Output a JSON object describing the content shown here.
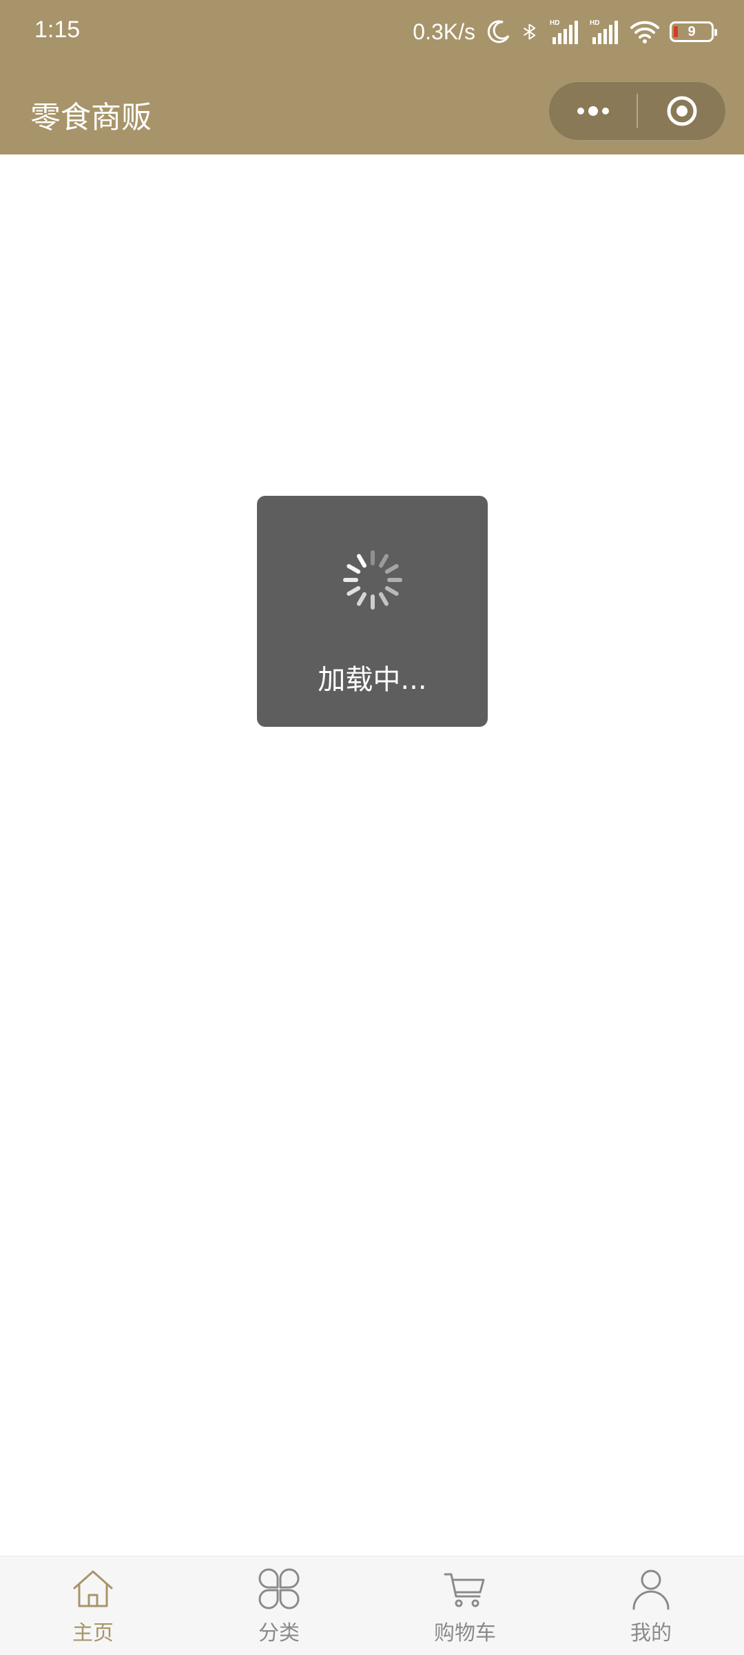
{
  "status_bar": {
    "time": "1:15",
    "net_speed": "0.3K/s",
    "battery": "9",
    "icons": [
      "moon-icon",
      "bluetooth-icon",
      "hd-signal-icon",
      "hd-signal-icon",
      "wifi-icon",
      "battery-icon"
    ]
  },
  "nav": {
    "title": "零食商贩",
    "capsule": {
      "more_icon": "more-dots-icon",
      "close_icon": "target-circle-icon"
    }
  },
  "loading": {
    "text": "加载中..."
  },
  "tabbar": {
    "tabs": [
      {
        "label": "主页",
        "icon": "home-icon",
        "active": true
      },
      {
        "label": "分类",
        "icon": "category-icon",
        "active": false
      },
      {
        "label": "购物车",
        "icon": "cart-icon",
        "active": false
      },
      {
        "label": "我的",
        "icon": "profile-icon",
        "active": false
      }
    ]
  },
  "colors": {
    "theme": "#a8946a",
    "toast_bg": "#5e5e5e",
    "tab_inactive": "#8a8a8a",
    "battery_low": "#d83a2a"
  }
}
